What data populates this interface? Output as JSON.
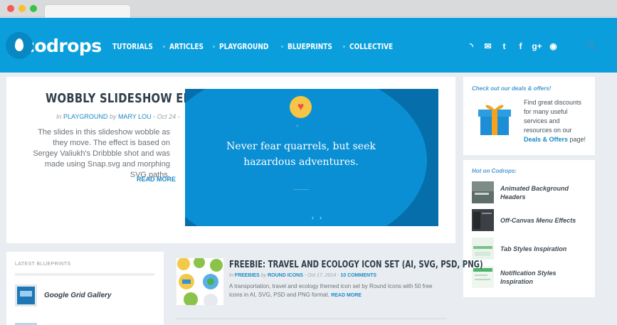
{
  "brand": {
    "name": "codrops",
    "accent": "#0a9fdc"
  },
  "nav": [
    "TUTORIALS",
    "ARTICLES",
    "PLAYGROUND",
    "BLUEPRINTS",
    "COLLECTIVE"
  ],
  "social_icons": [
    "rss-icon",
    "mail-icon",
    "twitter-icon",
    "facebook-icon",
    "google-plus-icon",
    "github-icon"
  ],
  "social_glyphs": [
    "◝",
    "✉",
    "t",
    "f",
    "g+",
    "◉"
  ],
  "featured": {
    "title": "WOBBLY SLIDESHOW EFFECT",
    "meta_in": "In",
    "category": "PLAYGROUND",
    "meta_by": "by",
    "author": "MARY LOU",
    "date": "- Oct 24 -",
    "description": "The slides in this slideshow wobble as they move. The effect is based on Sergey Valiukh's Dribbble shot and was made using Snap.svg and morphing SVG paths.",
    "read_more": "READ MORE",
    "slide": {
      "quote_mark": "“",
      "quote": "Never fear quarrels, but seek hazardous adventures.",
      "prev": "‹",
      "next": "›"
    }
  },
  "deals": {
    "heading": "Check out our deals & offers!",
    "text_before": "Find great discounts for many useful services and resources on our ",
    "link": "Deals & Offers",
    "text_after": " page!"
  },
  "hot": {
    "heading": "Hot on Codrops:",
    "items": [
      {
        "label": "Animated Background Headers"
      },
      {
        "label": "Off-Canvas Menu Effects"
      },
      {
        "label": "Tab Styles Inspiration"
      },
      {
        "label": "Notification Styles Inspiration"
      }
    ]
  },
  "blueprints": {
    "heading": "LATEST BLUEPRINTS",
    "items": [
      {
        "label": "Google Grid Gallery"
      }
    ]
  },
  "article": {
    "title": "FREEBIE: TRAVEL AND ECOLOGY ICON SET (AI, SVG, PSD, PNG)",
    "meta_in": "In",
    "category": "FREEBIES",
    "meta_by": "by",
    "author": "ROUND ICONS",
    "date": "- Oct 17, 2014 -",
    "comments": "10 COMMENTS",
    "description": "A transportation, travel and ecology themed icon set by Round Icons with 50 free icons in AI, SVG, PSD and PNG format.",
    "read_more": "READ MORE"
  }
}
